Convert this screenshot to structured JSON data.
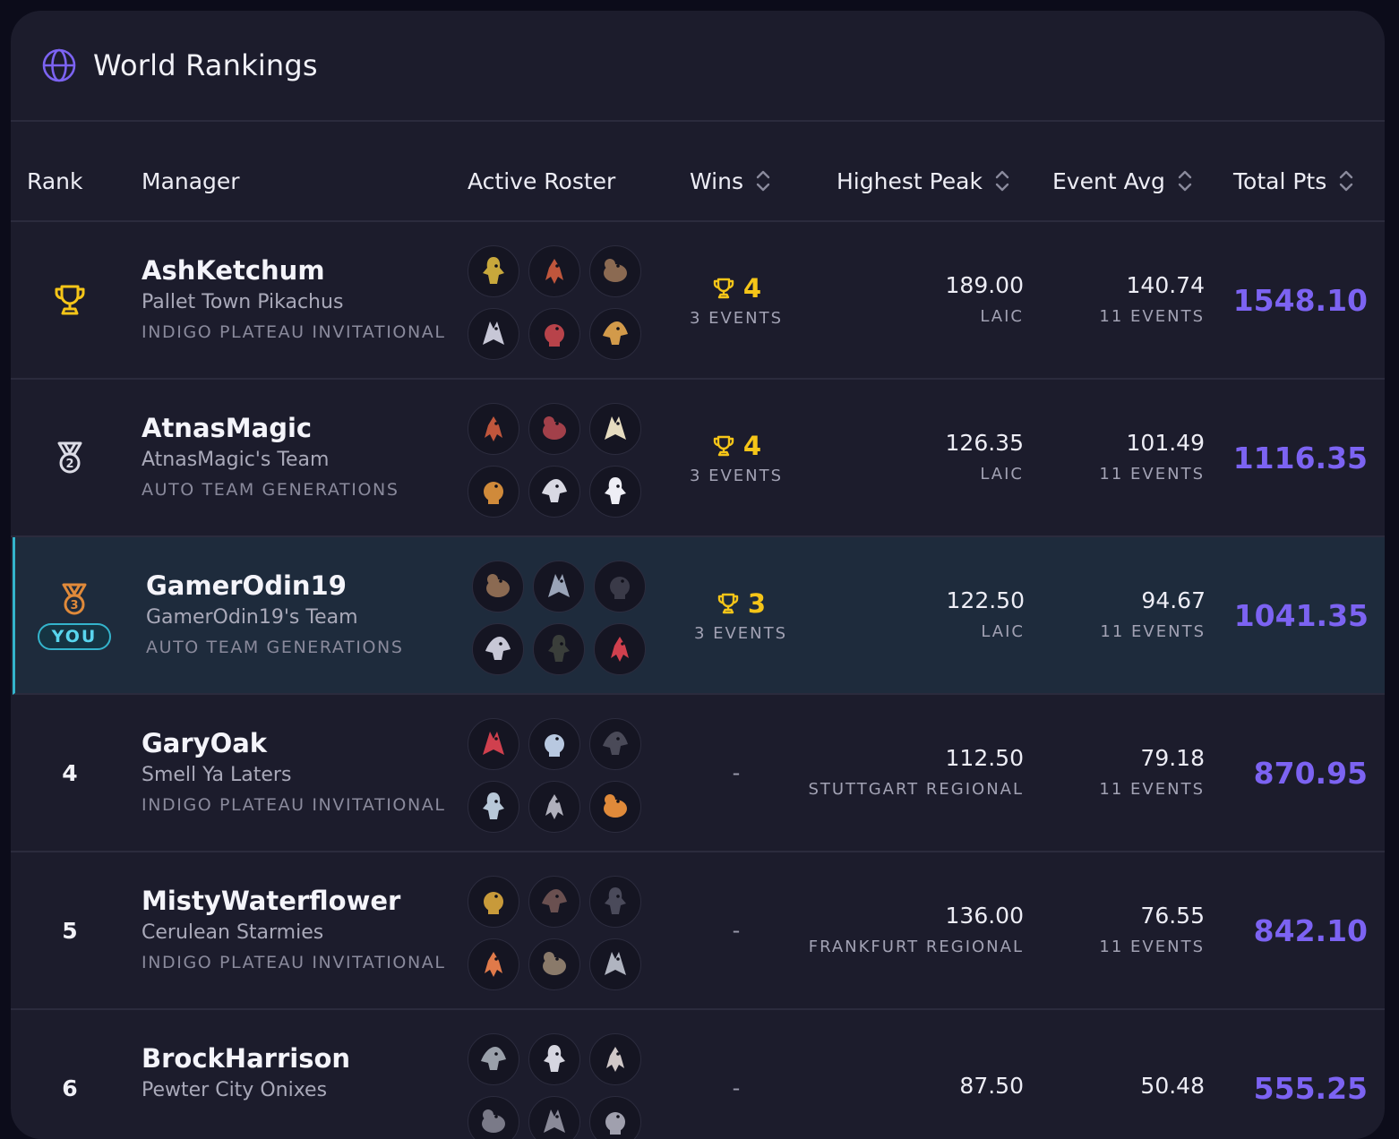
{
  "header": {
    "title": "World Rankings",
    "icon": "globe-icon",
    "accent": "#7c63f2"
  },
  "columns": {
    "rank": "Rank",
    "manager": "Manager",
    "roster": "Active Roster",
    "wins": "Wins",
    "peak": "Highest Peak",
    "avg": "Event Avg",
    "total": "Total Pts"
  },
  "rows": [
    {
      "rank": "1",
      "rank_icon": "trophy-icon",
      "you": false,
      "name": "AshKetchum",
      "team": "Pallet Town Pikachus",
      "league": "INDIGO PLATEAU INVITATIONAL",
      "wins": "4",
      "wins_sub": "3 EVENTS",
      "peak": "189.00",
      "peak_sub": "LAIC",
      "avg": "140.74",
      "avg_sub": "11 EVENTS",
      "total": "1548.10",
      "roster": [
        "#c8a83c",
        "#c0563c",
        "#8b6a52",
        "#c7c7d6",
        "#b8434a",
        "#d29a4a"
      ]
    },
    {
      "rank": "2",
      "rank_icon": "silver-medal-icon",
      "you": false,
      "name": "AtnasMagic",
      "team": "AtnasMagic's Team",
      "league": "AUTO TEAM GENERATIONS",
      "wins": "4",
      "wins_sub": "3 EVENTS",
      "peak": "126.35",
      "peak_sub": "LAIC",
      "avg": "101.49",
      "avg_sub": "11 EVENTS",
      "total": "1116.35",
      "roster": [
        "#c0563c",
        "#a2404a",
        "#e6dcc0",
        "#d08a3a",
        "#d9d9e3",
        "#eeeef5"
      ]
    },
    {
      "rank": "3",
      "rank_icon": "bronze-medal-icon",
      "you": true,
      "you_label": "YOU",
      "name": "GamerOdin19",
      "team": "GamerOdin19's Team",
      "league": "AUTO TEAM GENERATIONS",
      "wins": "3",
      "wins_sub": "3 EVENTS",
      "peak": "122.50",
      "peak_sub": "LAIC",
      "avg": "94.67",
      "avg_sub": "11 EVENTS",
      "total": "1041.35",
      "roster": [
        "#8b6a52",
        "#9aa4b8",
        "#3a3a48",
        "#c7c7d6",
        "#3a3e3a",
        "#d0404e"
      ]
    },
    {
      "rank": "4",
      "rank_icon": "",
      "you": false,
      "name": "GaryOak",
      "team": "Smell Ya Laters",
      "league": "INDIGO PLATEAU INVITATIONAL",
      "wins": "-",
      "wins_sub": "",
      "peak": "112.50",
      "peak_sub": "STUTTGART REGIONAL",
      "avg": "79.18",
      "avg_sub": "11 EVENTS",
      "total": "870.95",
      "roster": [
        "#d0404e",
        "#b8c8e0",
        "#4a4a58",
        "#b8c8d8",
        "#b0b0bc",
        "#e08a3a"
      ]
    },
    {
      "rank": "5",
      "rank_icon": "",
      "you": false,
      "name": "MistyWaterflower",
      "team": "Cerulean Starmies",
      "league": "INDIGO PLATEAU INVITATIONAL",
      "wins": "-",
      "wins_sub": "",
      "peak": "136.00",
      "peak_sub": "FRANKFURT REGIONAL",
      "avg": "76.55",
      "avg_sub": "11 EVENTS",
      "total": "842.10",
      "roster": [
        "#c89a3a",
        "#6a5050",
        "#4a4a5a",
        "#e07a4a",
        "#8a7a6a",
        "#b0b4c0"
      ]
    },
    {
      "rank": "6",
      "rank_icon": "",
      "you": false,
      "name": "BrockHarrison",
      "team": "Pewter City Onixes",
      "league": "",
      "wins": "-",
      "wins_sub": "",
      "peak": "87.50",
      "peak_sub": "",
      "avg": "50.48",
      "avg_sub": "",
      "total": "555.25",
      "roster": [
        "#9aa0aa",
        "#d6d6e0",
        "#d0c8c8",
        "#7a7a88",
        "#8a8a98",
        "#a0a0ae"
      ]
    }
  ]
}
